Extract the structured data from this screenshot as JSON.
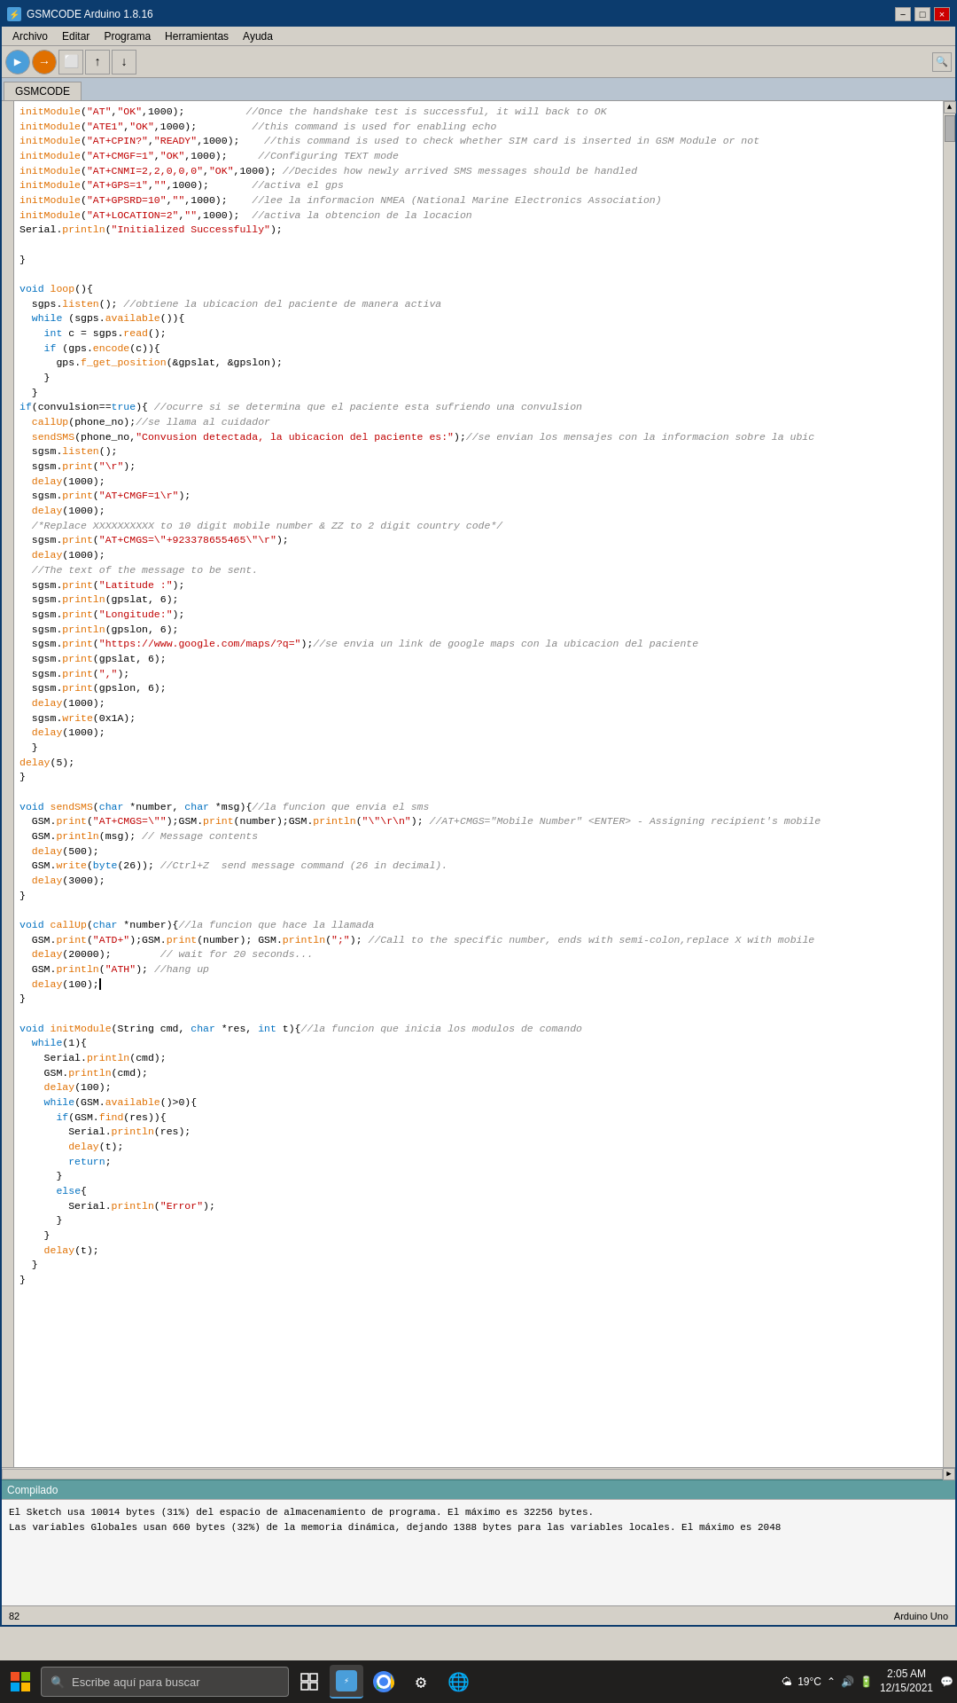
{
  "window": {
    "title": "GSMCODE Arduino 1.8.16",
    "icon": "⚡"
  },
  "titlebar": {
    "minimize": "−",
    "maximize": "□",
    "close": "×"
  },
  "menu": {
    "items": [
      "Archivo",
      "Editar",
      "Programa",
      "Herramientas",
      "Ayuda"
    ]
  },
  "toolbar": {
    "buttons": [
      "▶",
      "⬛",
      "⬜",
      "⬆",
      "⬇"
    ],
    "right_icon": "🔍"
  },
  "tab": {
    "label": "GSMCODE"
  },
  "compile_bar": {
    "label": "Compilado"
  },
  "console": {
    "line1": "El Sketch usa 10014 bytes (31%) del espacio de almacenamiento de programa. El máximo es 32256 bytes.",
    "line2": "Las variables Globales usan 660 bytes (32%) de la memoria dinámica, dejando 1388 bytes para las variables locales. El máximo es 2048"
  },
  "status_bar": {
    "line": "82",
    "board": "Arduino Uno"
  },
  "taskbar": {
    "search_placeholder": "Escribe aquí para buscar",
    "time": "2:05 AM",
    "date": "12/15/2021",
    "weather": "19°C"
  },
  "code_lines": [
    {
      "indent": 0,
      "content": "initModule(\"AT\",\"OK\",1000);",
      "comment": "//Once the handshake test is successful, it will back to OK",
      "type": "mixed"
    },
    {
      "indent": 0,
      "content": "initModule(\"ATE1\",\"OK\",1000);",
      "comment": "//this command is used for enabling echo",
      "type": "mixed"
    },
    {
      "indent": 0,
      "content": "initModule(\"AT+CPIN?\",\"READY\",1000);",
      "comment": "//this command is used to check whether SIM card is inserted in GSM Module or not",
      "type": "mixed"
    },
    {
      "indent": 0,
      "content": "initModule(\"AT+CMGF=1\",\"OK\",1000);",
      "comment": "//Configuring TEXT mode",
      "type": "mixed"
    },
    {
      "indent": 0,
      "content": "initModule(\"AT+CNMI=2,2,0,0,0\",\"OK\",1000);",
      "comment": "//Decides how newly arrived SMS messages should be handled",
      "type": "mixed"
    },
    {
      "indent": 0,
      "content": "initModule(\"AT+GPS=1\",\"\",1000);",
      "comment": "//activa el gps",
      "type": "mixed"
    },
    {
      "indent": 0,
      "content": "initModule(\"AT+GPSRD=10\",\"\",1000);",
      "comment": "//lee la informacion NMEA (National Marine Electronics Association)",
      "type": "mixed"
    },
    {
      "indent": 0,
      "content": "initModule(\"AT+LOCATION=2\",\"\",1000);",
      "comment": "//activa la obtencion de la locacion",
      "type": "mixed"
    },
    {
      "indent": 0,
      "content": "Serial.println(\"Initialized Successfully\");",
      "comment": "",
      "type": "code"
    },
    {
      "indent": 0,
      "content": "",
      "comment": "",
      "type": "blank"
    },
    {
      "indent": 0,
      "content": "}",
      "comment": "",
      "type": "code"
    },
    {
      "indent": 0,
      "content": "",
      "comment": "",
      "type": "blank"
    },
    {
      "indent": 0,
      "content": "void loop(){",
      "comment": "",
      "type": "code"
    },
    {
      "indent": 2,
      "content": "sgps.listen(); //obtiene la ubicacion del paciente de manera activa",
      "comment": "",
      "type": "code"
    },
    {
      "indent": 2,
      "content": "while (sgps.available()){",
      "comment": "",
      "type": "code"
    },
    {
      "indent": 4,
      "content": "int c = sgps.read();",
      "comment": "",
      "type": "code"
    },
    {
      "indent": 4,
      "content": "if (gps.encode(c)){",
      "comment": "",
      "type": "code"
    },
    {
      "indent": 6,
      "content": "gps.f_get_position(&gpslat, &gpslon);",
      "comment": "",
      "type": "code"
    },
    {
      "indent": 4,
      "content": "}",
      "comment": "",
      "type": "code"
    },
    {
      "indent": 2,
      "content": "}",
      "comment": "",
      "type": "code"
    },
    {
      "indent": 0,
      "content": "if(convulsion==true){ //ocurre si se determina que el paciente esta sufriendo una convulsion",
      "comment": "",
      "type": "code"
    },
    {
      "indent": 2,
      "content": "callUp(phone_no);//se llama al cuidador",
      "comment": "",
      "type": "code"
    },
    {
      "indent": 2,
      "content": "sendSMS(phone_no,\"Convusion detectada, la ubicacion del paciente es:\");//se envian los mensajes con la informacion sobre la ubic",
      "comment": "",
      "type": "code"
    },
    {
      "indent": 2,
      "content": "sgsm.listen();",
      "comment": "",
      "type": "code"
    },
    {
      "indent": 2,
      "content": "sgsm.print(\"\\r\");",
      "comment": "",
      "type": "code"
    },
    {
      "indent": 2,
      "content": "delay(1000);",
      "comment": "",
      "type": "code"
    },
    {
      "indent": 2,
      "content": "sgsm.print(\"AT+CMGF=1\\r\");",
      "comment": "",
      "type": "code"
    },
    {
      "indent": 2,
      "content": "delay(1000);",
      "comment": "",
      "type": "code"
    },
    {
      "indent": 2,
      "content": "/*Replace XXXXXXXXXX to 10 digit mobile number & ZZ to 2 digit country code*/",
      "comment": "",
      "type": "comment-line"
    },
    {
      "indent": 2,
      "content": "sgsm.print(\"AT+CMGS=\\\"+923378655465\\\"\\r\");",
      "comment": "",
      "type": "code"
    },
    {
      "indent": 2,
      "content": "delay(1000);",
      "comment": "",
      "type": "code"
    },
    {
      "indent": 2,
      "content": "//The text of the message to be sent.",
      "comment": "",
      "type": "comment-line"
    },
    {
      "indent": 2,
      "content": "sgsm.print(\"Latitude :\");",
      "comment": "",
      "type": "code"
    },
    {
      "indent": 2,
      "content": "sgsm.println(gpslat, 6);",
      "comment": "",
      "type": "code"
    },
    {
      "indent": 2,
      "content": "sgsm.print(\"Longitude:\");",
      "comment": "",
      "type": "code"
    },
    {
      "indent": 2,
      "content": "sgsm.println(gpslon, 6);",
      "comment": "",
      "type": "code"
    },
    {
      "indent": 2,
      "content": "sgsm.print(\"https://www.google.com/maps/?q=\");//se envia un link de google maps con la ubicacion del paciente",
      "comment": "",
      "type": "code"
    },
    {
      "indent": 2,
      "content": "sgsm.print(gpslat, 6);",
      "comment": "",
      "type": "code"
    },
    {
      "indent": 2,
      "content": "sgsm.print(\",\");",
      "comment": "",
      "type": "code"
    },
    {
      "indent": 2,
      "content": "sgsm.print(gpslon, 6);",
      "comment": "",
      "type": "code"
    },
    {
      "indent": 2,
      "content": "delay(1000);",
      "comment": "",
      "type": "code"
    },
    {
      "indent": 2,
      "content": "sgsm.write(0x1A);",
      "comment": "",
      "type": "code"
    },
    {
      "indent": 2,
      "content": "delay(1000);",
      "comment": "",
      "type": "code"
    },
    {
      "indent": 0,
      "content": "}",
      "comment": "",
      "type": "code"
    },
    {
      "indent": 0,
      "content": "delay(5);",
      "comment": "",
      "type": "code"
    },
    {
      "indent": 0,
      "content": "}",
      "comment": "",
      "type": "code"
    },
    {
      "indent": 0,
      "content": "",
      "comment": "",
      "type": "blank"
    },
    {
      "indent": 0,
      "content": "void sendSMS(char *number, char *msg){//la funcion que envia el sms",
      "comment": "",
      "type": "code"
    },
    {
      "indent": 2,
      "content": "GSM.print(\"AT+CMGS=\\\"\");GSM.print(number);GSM.println(\"\\\"\\r\\n\"); //AT+CMGS=\"Mobile Number\" <ENTER> - Assigning recipient's mobile",
      "comment": "",
      "type": "code"
    },
    {
      "indent": 2,
      "content": "GSM.println(msg); // Message contents",
      "comment": "",
      "type": "code"
    },
    {
      "indent": 2,
      "content": "delay(500);",
      "comment": "",
      "type": "code"
    },
    {
      "indent": 2,
      "content": "GSM.write(byte(26)); //Ctrl+Z  send message command (26 in decimal).",
      "comment": "",
      "type": "code"
    },
    {
      "indent": 2,
      "content": "delay(3000);",
      "comment": "",
      "type": "code"
    },
    {
      "indent": 0,
      "content": "}",
      "comment": "",
      "type": "code"
    },
    {
      "indent": 0,
      "content": "",
      "comment": "",
      "type": "blank"
    },
    {
      "indent": 0,
      "content": "void callUp(char *number){//la funcion que hace la llamada",
      "comment": "",
      "type": "code"
    },
    {
      "indent": 2,
      "content": "GSM.print(\"ATD+\");GSM.print(number); GSM.println(\";\"); //Call to the specific number, ends with semi-colon,replace X with mobile",
      "comment": "",
      "type": "code"
    },
    {
      "indent": 2,
      "content": "delay(20000);        // wait for 20 seconds...",
      "comment": "",
      "type": "code"
    },
    {
      "indent": 2,
      "content": "GSM.println(\"ATH\"); //hang up",
      "comment": "",
      "type": "code"
    },
    {
      "indent": 2,
      "content": "delay(100);",
      "comment": "",
      "type": "code"
    },
    {
      "indent": 0,
      "content": "}",
      "comment": "",
      "type": "code"
    },
    {
      "indent": 0,
      "content": "",
      "comment": "",
      "type": "blank"
    },
    {
      "indent": 0,
      "content": "void initModule(String cmd, char *res, int t){//la funcion que inicia los modulos de comando",
      "comment": "",
      "type": "code"
    },
    {
      "indent": 2,
      "content": "while(1){",
      "comment": "",
      "type": "code"
    },
    {
      "indent": 4,
      "content": "Serial.println(cmd);",
      "comment": "",
      "type": "code"
    },
    {
      "indent": 4,
      "content": "GSM.println(cmd);",
      "comment": "",
      "type": "code"
    },
    {
      "indent": 4,
      "content": "delay(100);",
      "comment": "",
      "type": "code"
    },
    {
      "indent": 4,
      "content": "while(GSM.available()>0){",
      "comment": "",
      "type": "code"
    },
    {
      "indent": 6,
      "content": "if(GSM.find(res)){",
      "comment": "",
      "type": "code"
    },
    {
      "indent": 8,
      "content": "Serial.println(res);",
      "comment": "",
      "type": "code"
    },
    {
      "indent": 8,
      "content": "delay(t);",
      "comment": "",
      "type": "code"
    },
    {
      "indent": 8,
      "content": "return;",
      "comment": "",
      "type": "code"
    },
    {
      "indent": 6,
      "content": "}",
      "comment": "",
      "type": "code"
    },
    {
      "indent": 6,
      "content": "else{",
      "comment": "",
      "type": "code"
    },
    {
      "indent": 8,
      "content": "Serial.println(\"Error\");",
      "comment": "",
      "type": "code"
    },
    {
      "indent": 6,
      "content": "}",
      "comment": "",
      "type": "code"
    },
    {
      "indent": 4,
      "content": "}",
      "comment": "",
      "type": "code"
    },
    {
      "indent": 4,
      "content": "delay(t);",
      "comment": "",
      "type": "code"
    },
    {
      "indent": 2,
      "content": "}",
      "comment": "",
      "type": "code"
    },
    {
      "indent": 0,
      "content": "}",
      "comment": "",
      "type": "code"
    }
  ]
}
